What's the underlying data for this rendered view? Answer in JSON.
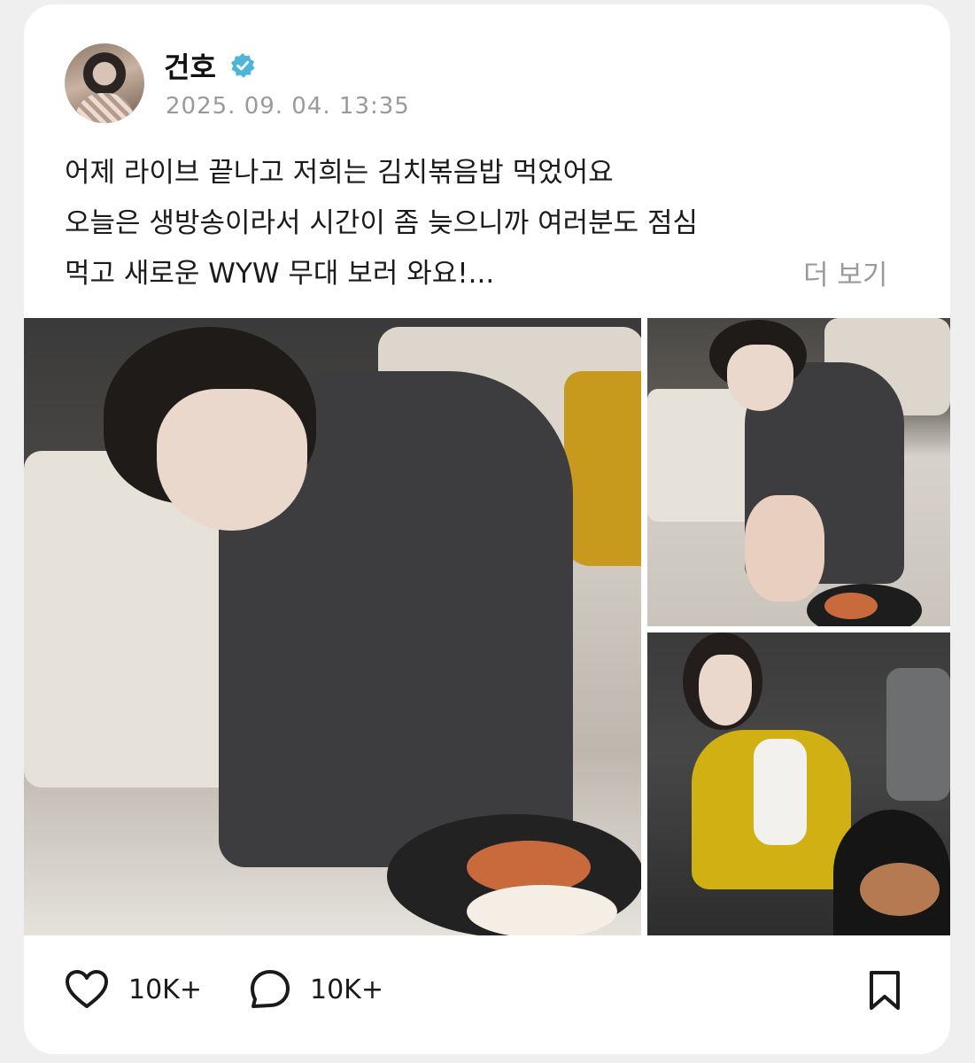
{
  "post": {
    "author": {
      "name": "건호",
      "verified": true,
      "avatar_icon": "profile-photo"
    },
    "timestamp": "2025. 09. 04. 13:35",
    "text_lines": [
      "어제 라이브 끝나고 저희는 김치볶음밥 먹었어요",
      "오늘은 생방송이라서 시간이 좀 늦으니까 여러분도 점심",
      "먹고 새로운 WYW 무대 보러 와요!..."
    ],
    "more_label": "더 보기",
    "photos": [
      {
        "icon": "photo"
      },
      {
        "icon": "photo"
      },
      {
        "icon": "photo"
      }
    ],
    "actions": {
      "like_count": "10K+",
      "comment_count": "10K+",
      "like_icon": "heart-icon",
      "comment_icon": "comment-bubble-icon",
      "bookmark_icon": "bookmark-icon"
    }
  },
  "colors": {
    "verified_badge": "#4cb6d8",
    "muted_text": "#9a9a9a",
    "card_bg": "#ffffff",
    "page_bg": "#efefef"
  }
}
